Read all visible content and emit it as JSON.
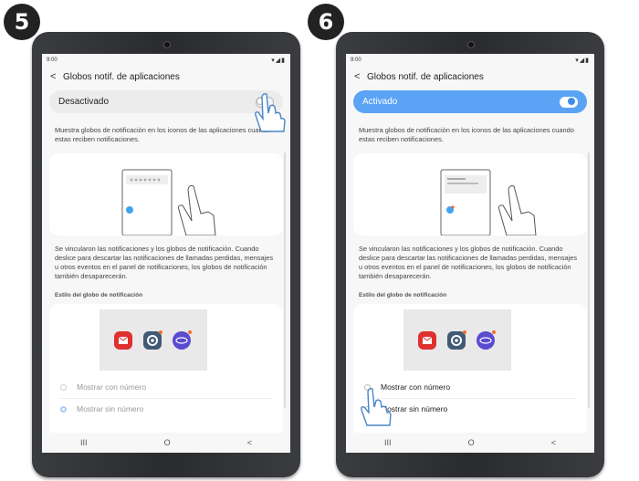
{
  "steps": [
    "5",
    "6"
  ],
  "status": {
    "time": "9:00",
    "icons": "▾◢▮"
  },
  "panels": [
    {
      "title": "Globos notif. de aplicaciones",
      "toggle_label": "Desactivado",
      "toggle_on": false,
      "description": "Muestra globos de notificación en los iconos de las aplicaciones cuando estas reciben notificaciones.",
      "description2": "Se vincularon las notificaciones y los globos de notificación. Cuando deslice para descartar las notificaciones de llamadas perdidas, mensajes u otros eventos en el panel de notificaciones, los globos de notificación también desaparecerán.",
      "section_label": "Estilo del globo de notificación",
      "options": [
        "Mostrar con número",
        "Mostrar sin número"
      ],
      "selected_option": 1,
      "options_enabled": false
    },
    {
      "title": "Globos notif. de aplicaciones",
      "toggle_label": "Activado",
      "toggle_on": true,
      "description": "Muestra globos de notificación en los iconos de las aplicaciones cuando estas reciben notificaciones.",
      "description2": "Se vincularon las notificaciones y los globos de notificación. Cuando deslice para descartar las notificaciones de llamadas perdidas, mensajes u otros eventos en el panel de notificaciones, los globos de notificación también desaparecerán.",
      "section_label": "Estilo del globo de notificación",
      "options": [
        "Mostrar con número",
        "Mostrar sin número"
      ],
      "selected_option": 0,
      "options_enabled": true
    }
  ],
  "navbar": {
    "recent": "III",
    "home": "O",
    "back": "<"
  },
  "colors": {
    "accent": "#5aa3f5",
    "badge": "#f36b2b",
    "email": "#e0302f",
    "settings": "#3f5a75",
    "internet": "#5a4bd1"
  },
  "icons": [
    "email-icon",
    "settings-icon",
    "internet-icon",
    "hand-pointer-icon"
  ]
}
